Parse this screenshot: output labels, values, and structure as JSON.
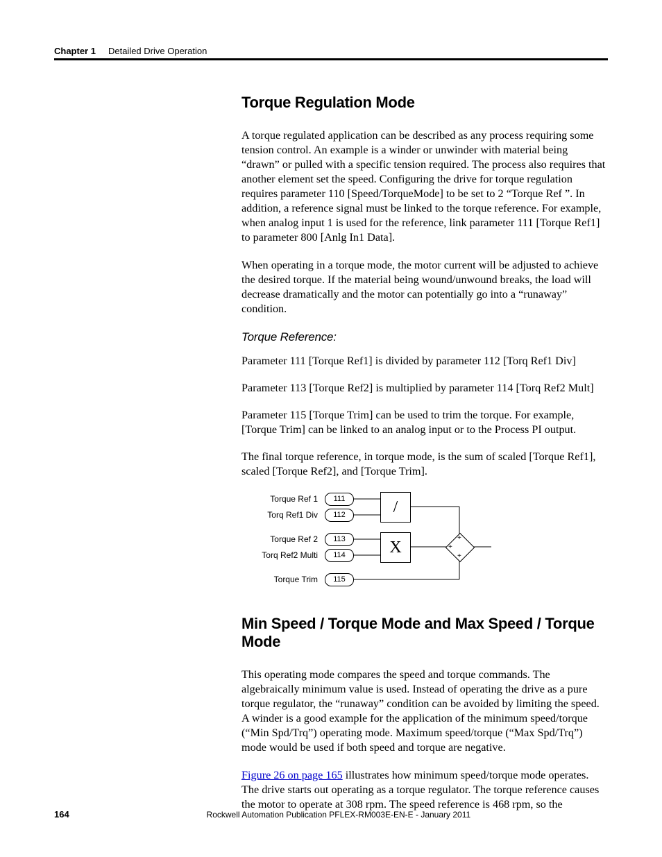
{
  "header": {
    "chapter": "Chapter 1",
    "section": "Detailed Drive Operation"
  },
  "section1": {
    "title": "Torque Regulation Mode",
    "p1": "A torque regulated application can be described as any process requiring some tension control. An example is a winder or unwinder with material being “drawn” or pulled with a specific tension required. The process also requires that another element set the speed. Configuring the drive for torque regulation requires parameter 110 [Speed/TorqueMode] to be set to 2 “Torque Ref ”. In addition, a reference signal must be linked to the torque reference. For example, when analog input 1 is used for the reference, link parameter 111 [Torque Ref1] to parameter 800 [Anlg In1 Data].",
    "p2": "When operating in a torque mode, the motor current will be adjusted to achieve the desired torque. If the material being wound/unwound breaks, the load will decrease dramatically and the motor can potentially go into a “runaway” condition.",
    "sub": "Torque Reference:",
    "p3": "Parameter 111 [Torque Ref1] is divided by parameter 112 [Torq Ref1 Div]",
    "p4": "Parameter 113 [Torque Ref2] is multiplied by parameter 114 [Torq Ref2 Mult]",
    "p5": "Parameter 115 [Torque Trim] can be used to trim the torque. For example, [Torque Trim] can be linked to an analog input or to the Process PI output.",
    "p6": "The final torque reference, in torque mode, is the sum of scaled [Torque Ref1], scaled [Torque Ref2], and [Torque Trim]."
  },
  "figure": {
    "labels": {
      "r1": "Torque Ref 1",
      "r2": "Torq Ref1 Div",
      "r3": "Torque Ref 2",
      "r4": "Torq Ref2 Multi",
      "r5": "Torque Trim"
    },
    "params": {
      "p1": "111",
      "p2": "112",
      "p3": "113",
      "p4": "114",
      "p5": "115"
    },
    "ops": {
      "div": "/",
      "mul": "X"
    },
    "sum": {
      "top": "+",
      "left": "+",
      "bot": "+"
    }
  },
  "section2": {
    "title": "Min Speed / Torque Mode and Max Speed / Torque Mode",
    "p1": "This operating mode compares the speed and torque commands. The algebraically minimum value is used. Instead of operating the drive as a pure torque regulator, the “runaway” condition can be avoided by limiting the speed. A winder is a good example for the application of the minimum speed/torque (“Min Spd/Trq”) operating mode. Maximum speed/torque (“Max Spd/Trq”) mode would be used if both speed and torque are negative.",
    "link": "Figure 26 on page 165",
    "p2a": " illustrates how minimum speed/torque mode operates. The drive starts out operating as a torque regulator. The torque reference causes the motor to operate at 308 rpm. The speed reference is 468 rpm, so the"
  },
  "footer": {
    "page": "164",
    "pub": "Rockwell Automation Publication PFLEX-RM003E-EN-E - January 2011"
  }
}
